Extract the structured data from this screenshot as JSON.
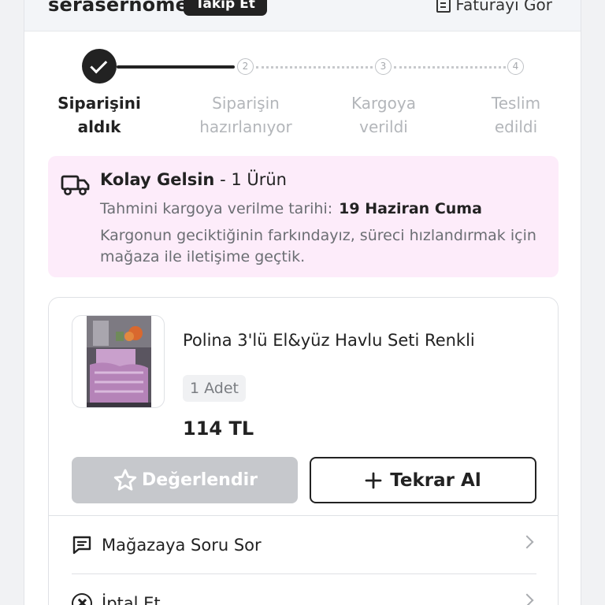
{
  "header": {
    "store_name": "serasernome",
    "follow_label": "Takip Et",
    "invoice_label": "Faturayı Gör"
  },
  "stepper": {
    "steps": [
      {
        "label_line1": "Siparişini",
        "label_line2": "aldık",
        "state": "done"
      },
      {
        "number": "2",
        "label_line1": "Siparişin",
        "label_line2": "hazırlanıyor",
        "state": "pending"
      },
      {
        "number": "3",
        "label_line1": "Kargoya",
        "label_line2": "verildi",
        "state": "pending"
      },
      {
        "number": "4",
        "label_line1": "Teslim",
        "label_line2": "edildi",
        "state": "pending"
      }
    ]
  },
  "shipping": {
    "carrier": "Kolay Gelsin",
    "count_text": " - 1 Ürün",
    "eta_label": "Tahmini kargoya verilme tarihi:",
    "eta_value": "19 Haziran Cuma",
    "delay_note": "Kargonun geciktiğinin farkındayız, süreci hızlandırmak için mağaza ile iletişime geçtik.",
    "icon": "truck-icon",
    "background": "#fdecfa"
  },
  "product": {
    "title": "Polina 3'lü El&yüz Havlu Seti Renkli",
    "quantity": "1 Adet",
    "price": "114 TL",
    "rate_label": "Değerlendir",
    "reorder_label": "Tekrar Al"
  },
  "menu": {
    "ask_store_label": "Mağazaya Soru Sor",
    "cancel_label": "İptal Et"
  }
}
